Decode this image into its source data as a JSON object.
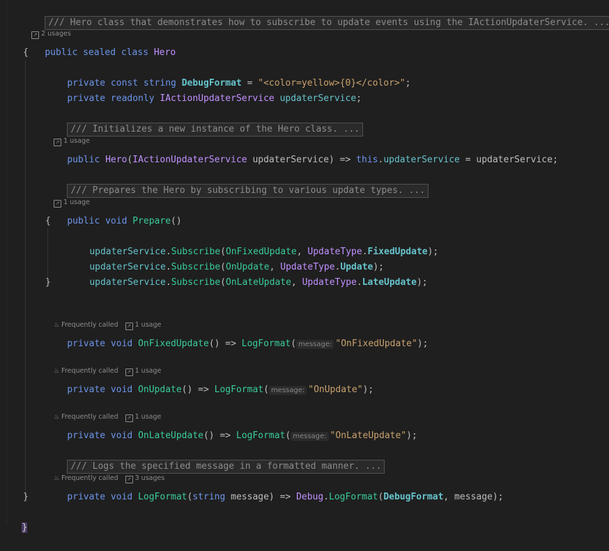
{
  "editor": {
    "summary_doc": "/// Hero class that demonstrates how to subscribe to update events using the IActionUpdaterService. ...",
    "class_usages": "2 usages",
    "class_decl": {
      "kw": "public sealed class ",
      "name": "Hero"
    },
    "open_brace": "{",
    "field1": {
      "kw1": "private const ",
      "kw2": "string ",
      "name": "DebugFormat",
      "op": " = ",
      "value": "\"<color=yellow>{0}</color>\"",
      "end": ";"
    },
    "field2": {
      "kw1": "private readonly ",
      "type": "IActionUpdaterService",
      "sp": " ",
      "name": "updaterService",
      "end": ";"
    },
    "ctor_doc": "/// Initializes a new instance of the Hero class. ...",
    "ctor_usages": "1 usage",
    "ctor": {
      "kw": "public ",
      "name": "Hero",
      "p1": "(",
      "type": "IActionUpdaterService",
      "p2": " updaterService) => ",
      "this": "this",
      "dot": ".",
      "field": "updaterService",
      "rest": " = updaterService;"
    },
    "prepare_doc": "/// Prepares the Hero by subscribing to various update types. ...",
    "prepare_usages": "1 usage",
    "prepare": {
      "kw": "public void ",
      "name": "Prepare",
      "rest": "()"
    },
    "prepare_open": "{",
    "subscribe_lines": [
      {
        "recv": "updaterService",
        "dot": ".",
        "method": "Subscribe",
        "p1": "(",
        "cb": "OnFixedUpdate",
        "sep": ", ",
        "type": "UpdateType",
        "dot2": ".",
        "member": "FixedUpdate",
        "end": ");"
      },
      {
        "recv": "updaterService",
        "dot": ".",
        "method": "Subscribe",
        "p1": "(",
        "cb": "OnUpdate",
        "sep": ", ",
        "type": "UpdateType",
        "dot2": ".",
        "member": "Update",
        "end": ");"
      },
      {
        "recv": "updaterService",
        "dot": ".",
        "method": "Subscribe",
        "p1": "(",
        "cb": "OnLateUpdate",
        "sep": ", ",
        "type": "UpdateType",
        "dot2": ".",
        "member": "LateUpdate",
        "end": ");"
      }
    ],
    "prepare_close": "}",
    "freq_label": "Frequently called",
    "one_usage": "1 usage",
    "three_usages": "3 usages",
    "inlay_message": "message:",
    "on_fixed": {
      "kw": "private void ",
      "name": "OnFixedUpdate",
      "mid": "() => ",
      "call": "LogFormat",
      "p": "(",
      "arg": "\"OnFixedUpdate\"",
      "end": ");"
    },
    "on_update": {
      "kw": "private void ",
      "name": "OnUpdate",
      "mid": "() => ",
      "call": "LogFormat",
      "p": "(",
      "arg": "\"OnUpdate\"",
      "end": ");"
    },
    "on_late": {
      "kw": "private void ",
      "name": "OnLateUpdate",
      "mid": "() => ",
      "call": "LogFormat",
      "p": "(",
      "arg": "\"OnLateUpdate\"",
      "end": ");"
    },
    "log_doc": "/// Logs the specified message in a formatted manner. ...",
    "log": {
      "kw": "private void ",
      "name": "LogFormat",
      "p1": "(",
      "kw2": "string",
      "p2": " message) => ",
      "cls": "Debug",
      "dot": ".",
      "call": "LogFormat",
      "p3": "(",
      "cst": "DebugFormat",
      "end": ", message);"
    },
    "class_close": "}",
    "ns_close": "}"
  },
  "colors": {
    "background": "#1f1f1f",
    "keyword": "#6c95eb",
    "type": "#c191ff",
    "string": "#c9a26d",
    "member": "#66c3cc",
    "method": "#39cc9b"
  }
}
